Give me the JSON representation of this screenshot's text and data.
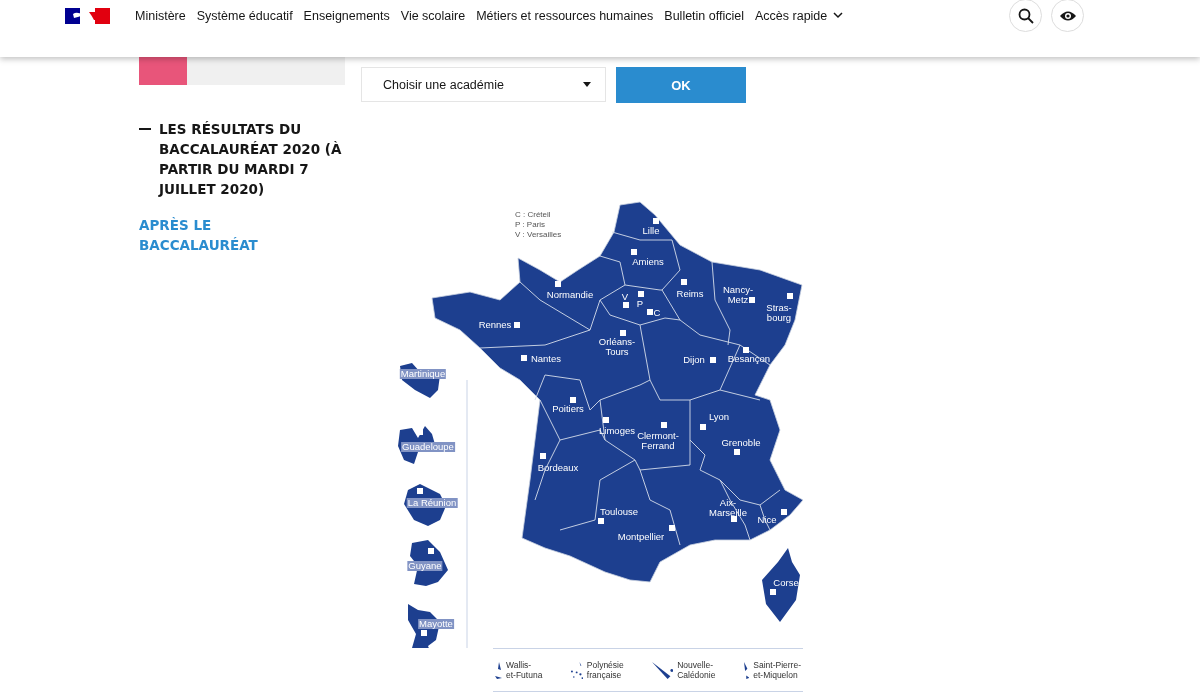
{
  "header": {
    "nav": [
      {
        "label": "Ministère"
      },
      {
        "label": "Système éducatif"
      },
      {
        "label": "Enseignements"
      },
      {
        "label": "Vie scolaire"
      },
      {
        "label": "Métiers et ressources humaines"
      },
      {
        "label": "Bulletin officiel"
      },
      {
        "label": "Accès rapide",
        "dropdown": true
      }
    ]
  },
  "sidebar": {
    "items": [
      {
        "label": "LES RÉSULTATS DU BACCALAURÉAT 2020 (À PARTIR DU MARDI 7 JUILLET 2020)",
        "selected": true
      },
      {
        "label": "APRÈS LE BACCALAURÉAT",
        "selected": false
      }
    ]
  },
  "academy_select": {
    "placeholder": "Choisir une académie",
    "button": "OK"
  },
  "map": {
    "legend": [
      "C : Créteil",
      "P : Paris",
      "V : Versailles"
    ],
    "academies": [
      {
        "name": "Lille"
      },
      {
        "name": "Amiens"
      },
      {
        "name": "Normandie"
      },
      {
        "name": "Reims"
      },
      {
        "name": "Nancy-\nMetz"
      },
      {
        "name": "Stras-\nbourg"
      },
      {
        "name": "Rennes"
      },
      {
        "name": "V"
      },
      {
        "name": "P"
      },
      {
        "name": "C"
      },
      {
        "name": "Orléans-\nTours"
      },
      {
        "name": "Nantes"
      },
      {
        "name": "Dijon"
      },
      {
        "name": "Besançon"
      },
      {
        "name": "Poitiers"
      },
      {
        "name": "Limoges"
      },
      {
        "name": "Clermont-\nFerrand"
      },
      {
        "name": "Lyon"
      },
      {
        "name": "Grenoble"
      },
      {
        "name": "Bordeaux"
      },
      {
        "name": "Toulouse"
      },
      {
        "name": "Aix-\nMarseille"
      },
      {
        "name": "Nice"
      },
      {
        "name": "Montpellier"
      },
      {
        "name": "Corse"
      }
    ],
    "overseas": [
      {
        "name": "Martinique"
      },
      {
        "name": "Guadeloupe"
      },
      {
        "name": "La Réunion"
      },
      {
        "name": "Guyane"
      },
      {
        "name": "Mayotte"
      }
    ],
    "territories": [
      {
        "name": "Wallis-\net-Futuna"
      },
      {
        "name": "Polynésie\nfrançaise"
      },
      {
        "name": "Nouvelle-\nCalédonie"
      },
      {
        "name": "Saint-Pierre-\net-Miquelon"
      }
    ]
  }
}
